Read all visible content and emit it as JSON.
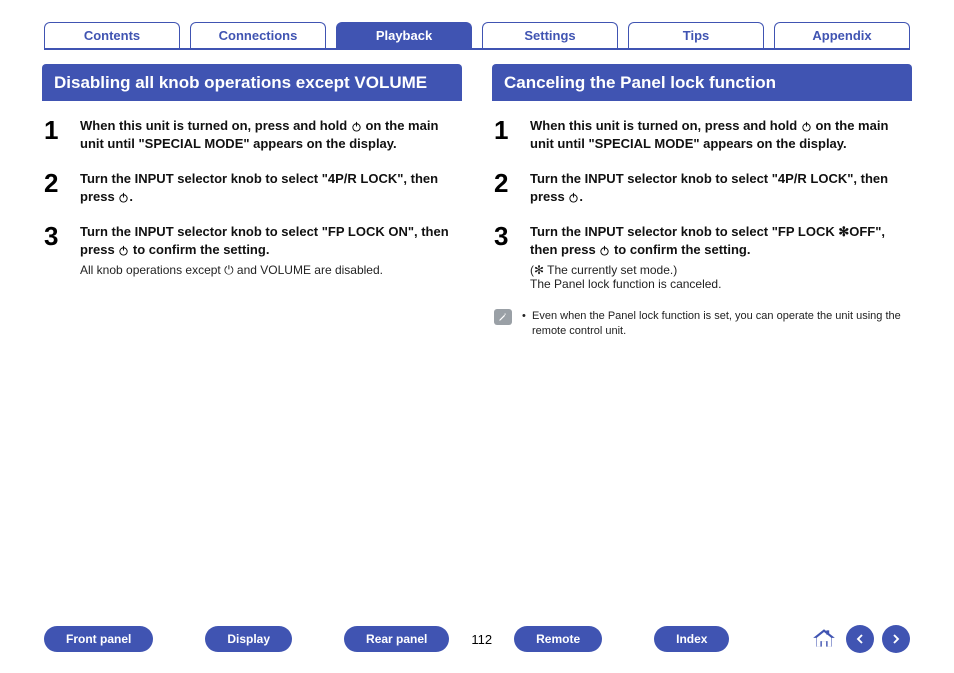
{
  "tabs": [
    {
      "id": "contents",
      "label": "Contents"
    },
    {
      "id": "connections",
      "label": "Connections"
    },
    {
      "id": "playback",
      "label": "Playback"
    },
    {
      "id": "settings",
      "label": "Settings"
    },
    {
      "id": "tips",
      "label": "Tips"
    },
    {
      "id": "appendix",
      "label": "Appendix"
    }
  ],
  "active_tab": "playback",
  "left": {
    "heading": "Disabling all knob operations except VOLUME",
    "steps": [
      {
        "n": "1",
        "title_a": "When this unit is turned on, press and hold ",
        "title_b": " on the main unit until \"SPECIAL MODE\" appears on the display.",
        "sub": ""
      },
      {
        "n": "2",
        "title_a": "Turn the INPUT selector knob to select \"4P/R LOCK\", then press ",
        "title_b": ".",
        "sub": ""
      },
      {
        "n": "3",
        "title_a": "Turn the INPUT selector knob to select \"FP LOCK ON\", then press ",
        "title_b": " to confirm the setting.",
        "sub": "All knob operations except ⏻ and VOLUME are disabled."
      }
    ]
  },
  "right": {
    "heading": "Canceling the Panel lock function",
    "steps": [
      {
        "n": "1",
        "title_a": "When this unit is turned on, press and hold ",
        "title_b": " on the main unit until \"SPECIAL MODE\" appears on the display.",
        "sub": ""
      },
      {
        "n": "2",
        "title_a": "Turn the INPUT selector knob to select \"4P/R LOCK\", then press ",
        "title_b": ".",
        "sub": ""
      },
      {
        "n": "3",
        "title_a": "Turn the INPUT selector knob to select \"FP LOCK ✻OFF\", then press ",
        "title_b": " to confirm the setting.",
        "sub": "(✻ The currently set mode.)\nThe Panel lock function is canceled."
      }
    ],
    "note": "Even when the Panel lock function is set, you can operate the unit using the remote control unit."
  },
  "footer": {
    "buttons": [
      "Front panel",
      "Display",
      "Rear panel"
    ],
    "page": "112",
    "buttons2": [
      "Remote",
      "Index"
    ]
  }
}
